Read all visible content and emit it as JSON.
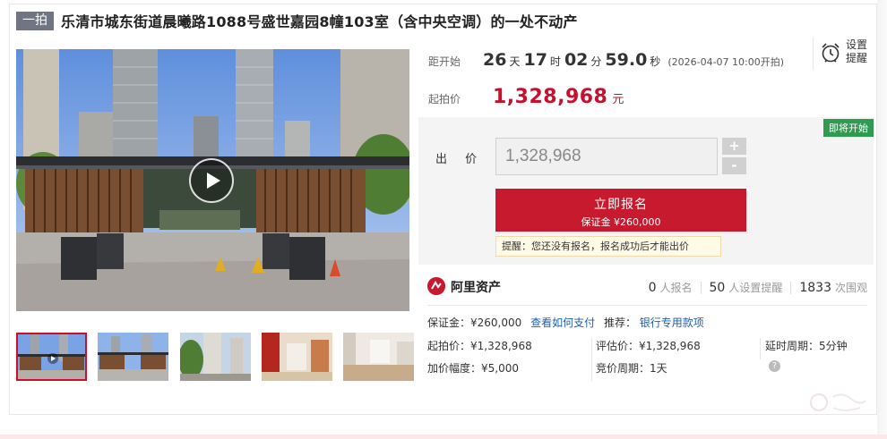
{
  "header": {
    "tag": "一拍",
    "title": "乐清市城东街道晨曦路1088号盛世嘉园8幢103室（含中央空调）的一处不动产"
  },
  "countdown": {
    "label": "距开始",
    "days": "26",
    "days_unit": "天",
    "hours": "17",
    "hours_unit": "时",
    "minutes": "02",
    "minutes_unit": "分",
    "seconds": "59.0",
    "seconds_unit": "秒",
    "start_text": "(2026-04-07 10:00开拍)"
  },
  "remind": {
    "line1": "设置",
    "line2": "提醒"
  },
  "start_price": {
    "label": "起拍价",
    "value": "1,328,968",
    "unit": "元"
  },
  "bid": {
    "badge": "即将开始",
    "label": "出 价",
    "input_value": "1,328,968",
    "plus": "+",
    "minus": "-",
    "signup_label": "立即报名",
    "deposit_text": "保证金 ¥260,000",
    "tip": "提醒：您还没有报名，报名成功后才能出价"
  },
  "brand": {
    "name": "阿里资产",
    "signups": "0",
    "signups_label": "人报名",
    "reminders": "50",
    "reminders_label": "人设置提醒",
    "views": "1833",
    "views_label": "次围观"
  },
  "details": {
    "deposit": "保证金：¥260,000",
    "how_to_pay": "查看如何支付",
    "recommend_label": "推荐：",
    "recommend_link": "银行专用款项",
    "start_price": "起拍价：¥1,328,968",
    "appraisal": "评估价：¥1,328,968",
    "delay": "延时周期：5分钟",
    "increment": "加价幅度：¥5,000",
    "cycle": "竞价周期：1天"
  },
  "colors": {
    "accent": "#c81a2f",
    "price": "#c6102e",
    "badge_green": "#2e9b51",
    "tag_gray": "#6f7583",
    "link": "#1d5fb4"
  },
  "icons": [
    "play-icon",
    "alarm-clock-icon",
    "ali-assets-logo-icon",
    "help-icon"
  ]
}
